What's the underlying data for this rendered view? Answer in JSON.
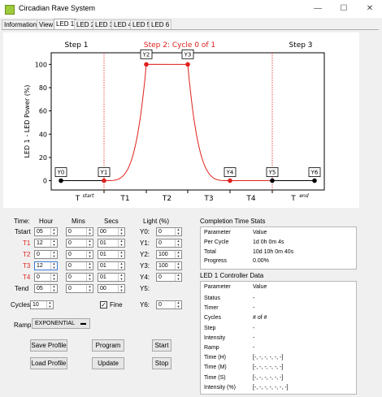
{
  "window": {
    "title": "Circadian Rave System",
    "minimize": "—",
    "maximize": "☐",
    "close": "✕"
  },
  "tabs": [
    "Information",
    "View",
    "LED 1",
    "LED 2",
    "LED 3",
    "LED 4",
    "LED 5",
    "LED 6"
  ],
  "active_tab": "LED 1",
  "chart_data": {
    "type": "line",
    "title": "Step 2: Cycle 0 of 1",
    "title_color": "#e0201b",
    "step_labels": [
      "Step 1",
      "Step 3"
    ],
    "ylabel": "LED 1 - LED Power (%)",
    "ylim": [
      -8,
      110
    ],
    "yticks": [
      0,
      20,
      40,
      60,
      80,
      100
    ],
    "x_segment_labels": [
      "T",
      "T1",
      "T2",
      "T3",
      "T4",
      "T"
    ],
    "x_segment_sup": [
      "start",
      "",
      "",
      "",
      "",
      "end"
    ],
    "points": [
      {
        "label": "Y0",
        "x": 0,
        "y": 0
      },
      {
        "label": "Y1",
        "x": 1,
        "y": 0
      },
      {
        "label": "Y2",
        "x": 2,
        "y": 100
      },
      {
        "label": "Y3",
        "x": 3,
        "y": 100
      },
      {
        "label": "Y4",
        "x": 4,
        "y": 0
      },
      {
        "label": "Y5",
        "x": 5,
        "y": 0
      },
      {
        "label": "Y6",
        "x": 6,
        "y": 0
      }
    ],
    "line_color": "#e0201b",
    "base_color": "#000000",
    "active_marker_color": "#e0201b",
    "dotted_line_color": "#e0201b"
  },
  "form": {
    "header": {
      "time": "Time:",
      "hour": "Hour",
      "mins": "Mins",
      "secs": "Secs",
      "light": "Light (%)"
    },
    "rows": [
      {
        "label": "Tstart",
        "red": false,
        "hour": "05",
        "mins": "0",
        "secs": "00",
        "ylabel": "Y0:",
        "light": "0"
      },
      {
        "label": "T1",
        "red": true,
        "hour": "12",
        "mins": "0",
        "secs": "01",
        "ylabel": "Y1:",
        "light": "0"
      },
      {
        "label": "T2",
        "red": true,
        "hour": "0",
        "mins": "0",
        "secs": "01",
        "ylabel": "Y2:",
        "light": "100"
      },
      {
        "label": "T3",
        "red": true,
        "hour": "12",
        "mins": "0",
        "secs": "01",
        "ylabel": "Y3:",
        "light": "100"
      },
      {
        "label": "T4",
        "red": true,
        "hour": "0",
        "mins": "0",
        "secs": "01",
        "ylabel": "Y4:",
        "light": "0"
      },
      {
        "label": "Tend",
        "red": false,
        "hour": "05",
        "mins": "0",
        "secs": "00",
        "ylabel": "Y5:",
        "light": ""
      }
    ],
    "y6_label": "Y6:",
    "y6_value": "0",
    "cycles_label": "Cycles:",
    "cycles_value": "10",
    "fine_label": "Fine",
    "fine_checked": "✓",
    "ramp_label": "Ramp:",
    "ramp_value": "EXPONENTIAL",
    "buttons": {
      "save_profile": "Save Profile",
      "program": "Program",
      "start": "Start",
      "load_profile": "Load Profile",
      "update": "Update",
      "stop": "Stop"
    }
  },
  "completion": {
    "title": "Completion Time Stats",
    "headers": [
      "Parameter",
      "Value"
    ],
    "rows": [
      [
        "Per Cycle",
        "1d 0h 0m 4s"
      ],
      [
        "Total",
        "10d 10h 0m 40s"
      ],
      [
        "Progress",
        "0.00%"
      ]
    ]
  },
  "controller": {
    "title": "LED 1 Controller Data",
    "headers": [
      "Parameter",
      "Value"
    ],
    "rows": [
      [
        "Status",
        "-"
      ],
      [
        "Timer",
        "-"
      ],
      [
        "Cycles",
        "# of #"
      ],
      [
        "Step",
        "-"
      ],
      [
        "Intensity",
        "-"
      ],
      [
        "Ramp",
        "-"
      ],
      [
        "Time (H)",
        "[-, -, -, -, -, -]"
      ],
      [
        "Time (M)",
        "[-, -, -, -, -, -]"
      ],
      [
        "Time (S)",
        "[-, -, -, -, -, -]"
      ],
      [
        "Intensity (%)",
        "[-, -, -, -, -, -, -]"
      ]
    ]
  }
}
